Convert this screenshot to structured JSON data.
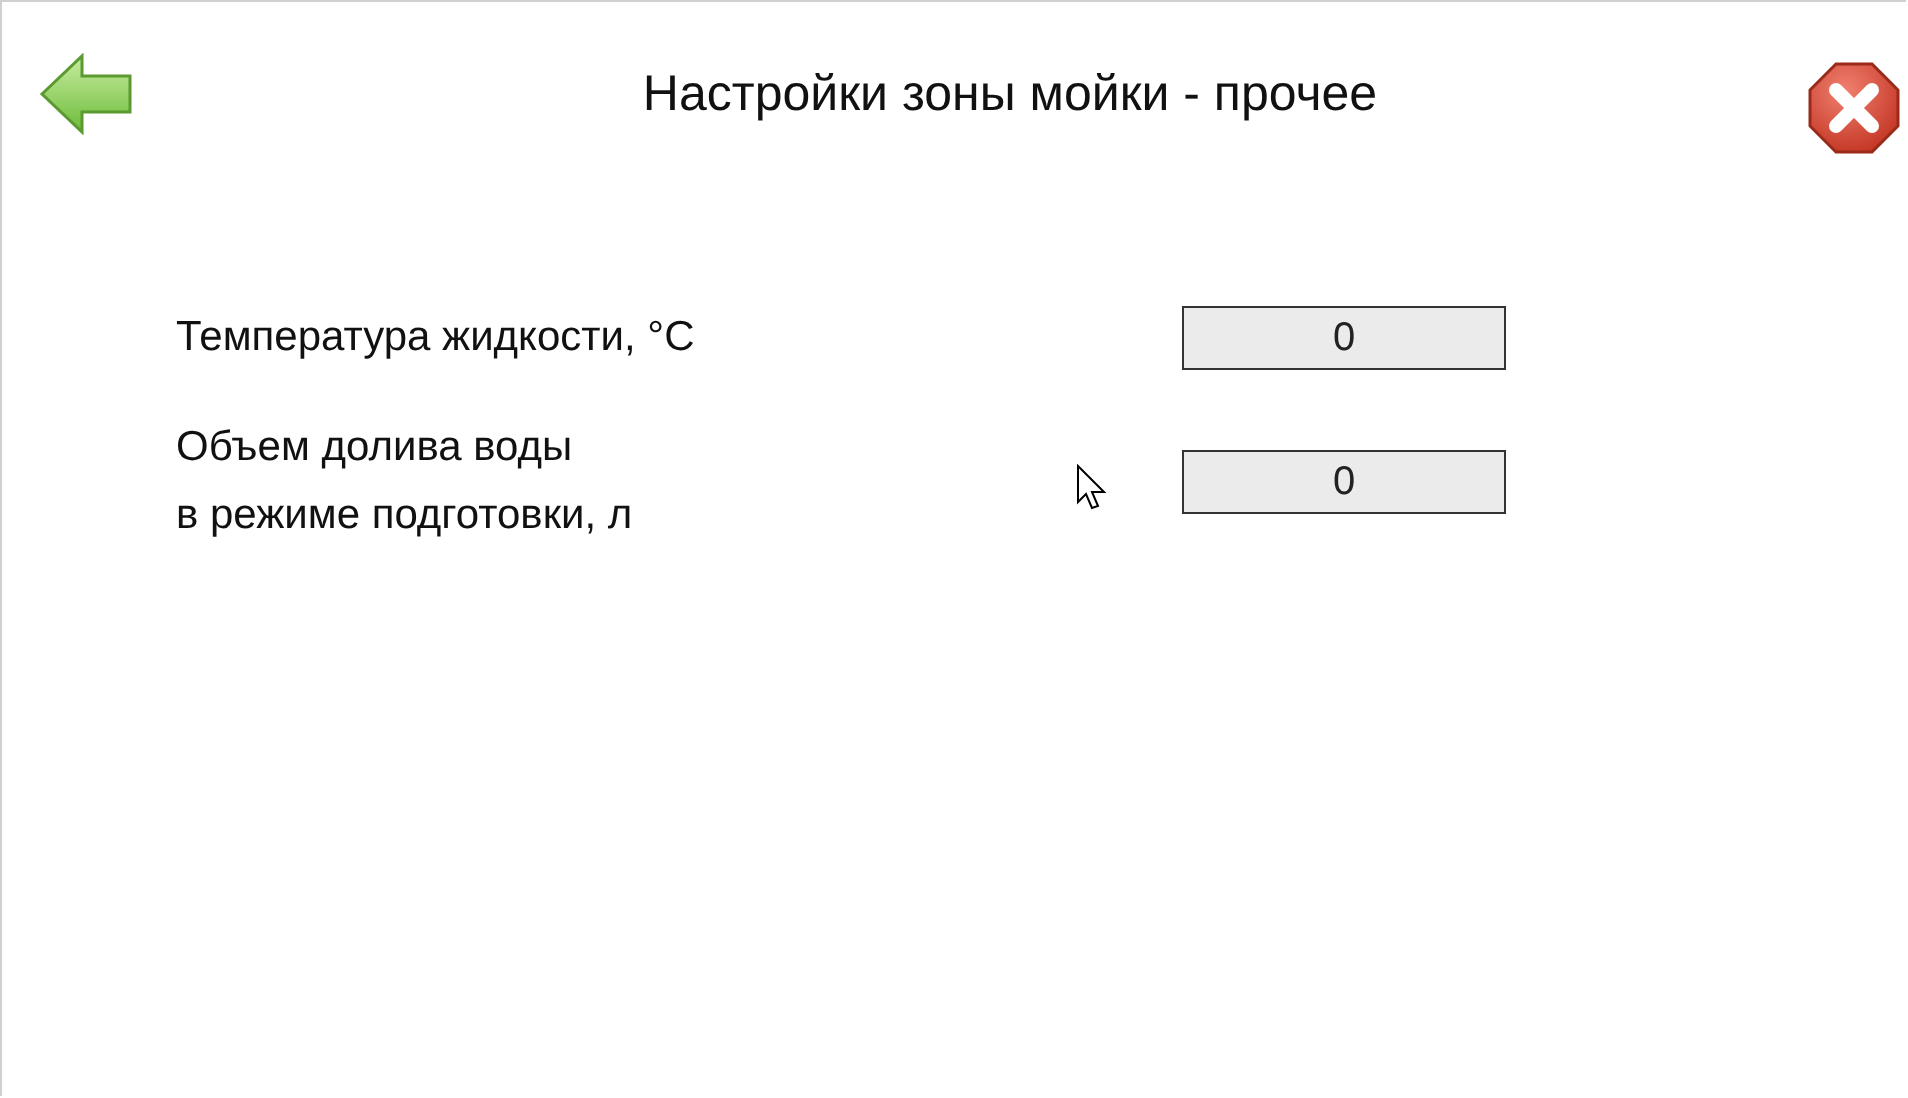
{
  "title": "Настройки зоны мойки - прочее",
  "settings": [
    {
      "label": "Температура жидкости, °С",
      "value": "0"
    },
    {
      "label": "Объем долива воды\nв режиме подготовки, л",
      "value": "0"
    }
  ]
}
